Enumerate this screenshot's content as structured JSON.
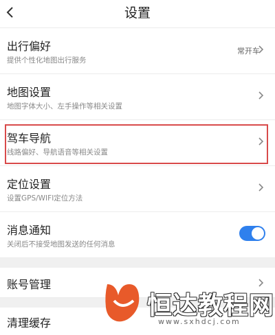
{
  "header": {
    "title": "设置",
    "back_icon": "back-arrow-icon"
  },
  "settings": {
    "travel_pref": {
      "title": "出行偏好",
      "subtitle": "提供个性化地图出行服务",
      "value": "常开车"
    },
    "map_settings": {
      "title": "地图设置",
      "subtitle": "地图字体大小、左手操作等相关设置"
    },
    "driving_nav": {
      "title": "驾车导航",
      "subtitle": "线路偏好、导航语音等相关设置"
    },
    "location": {
      "title": "定位设置",
      "subtitle": "设置GPS/WIFI定位方法"
    },
    "notifications": {
      "title": "消息通知",
      "subtitle": "关闭后不接受地图发送的任何消息",
      "enabled": true
    },
    "account": {
      "title": "账号管理"
    },
    "clear_cache": {
      "title": "清理缓存"
    }
  },
  "colors": {
    "toggle_on": "#2f80ed",
    "highlight": "#d84a4a",
    "logo": "#e85a2a"
  },
  "watermark": {
    "text": "恒达教程网",
    "url": "www.sxhdcj.com"
  }
}
